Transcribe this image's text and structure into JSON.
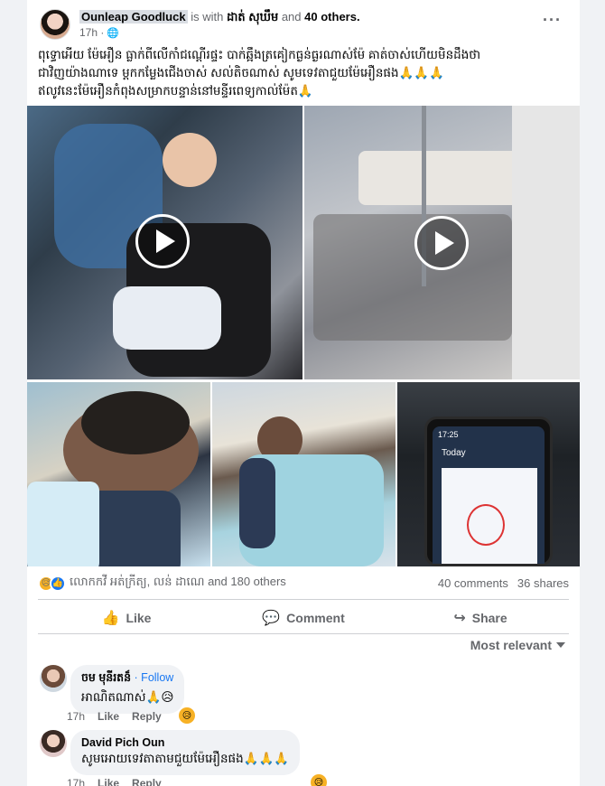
{
  "post": {
    "author": "Ounleap Goodluck",
    "with_text": "is with",
    "tagged_name": "ដាត់ សុឃឹម",
    "and_text": "and",
    "others_text": "40 others.",
    "time": "17h ·",
    "privacy_icon": "globe-icon",
    "text_lines": [
      "ពុទ្ធោអើយ ម៉ែអឿន ធ្លាក់ពីលើកាំជណ្ដើរផ្ទះ បាក់ឆ្អឹងត្រគៀកធ្ងន់ធ្ងរណាស់ម៉ែ  គាត់ចាស់ហើយមិនដឹងថា",
      "ជាវិញយ៉ាងណាទេ ម្ដកកម្លែងជើងចាស់ សល់តិចណាស់ សូមទេវតាជួយម៉ែអឿនផង🙏🙏🙏",
      "ឥលូវនេះម៉ែអឿនកំពុងសម្រាកបន្ទាន់នៅមន្ទីរពេទ្យកាល់ម៉ែត🙏"
    ]
  },
  "media": {
    "tiles": [
      {
        "label": "video-tile-1",
        "has_play": true
      },
      {
        "label": "video-tile-2",
        "has_play": true
      },
      {
        "label": "photo-tile-3",
        "has_play": false
      },
      {
        "label": "photo-tile-4",
        "has_play": false
      },
      {
        "label": "photo-tile-5",
        "has_play": false
      }
    ],
    "phone_time": "17:25",
    "phone_title": "Today"
  },
  "stats": {
    "reaction_names": "លោកកវី អត់ក្រីត្យ, លន់ ដាណេ and 180 others",
    "comments": "40 comments",
    "shares": "36 shares"
  },
  "actions": {
    "like": "Like",
    "comment": "Comment",
    "share": "Share"
  },
  "sort_label": "Most relevant",
  "comments": [
    {
      "name": "ចម មុនីរតន៏",
      "follow": "· Follow",
      "text": "អាណិតណាស់🙏😥",
      "time": "17h",
      "like": "Like",
      "reply": "Reply"
    },
    {
      "name": "David Pich Oun",
      "text": "សូមអោយទេវតាតាមជួយម៉ែអឿនផង🙏🙏🙏",
      "time": "17h",
      "like": "Like",
      "reply": "Reply"
    }
  ],
  "colors": {
    "link": "#1877f2",
    "muted": "#65676b",
    "bubble": "#f0f2f5"
  }
}
